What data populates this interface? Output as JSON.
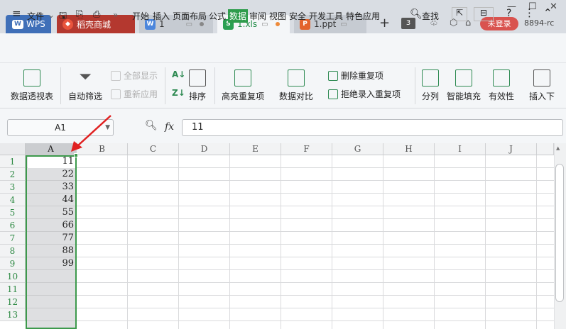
{
  "titlebar": {
    "tabs": [
      {
        "label": "WPS"
      },
      {
        "label": "稻壳商城"
      },
      {
        "label": "1"
      },
      {
        "label": "1.xls"
      },
      {
        "label": "1.ppt"
      }
    ],
    "window_count": "3",
    "login_label": "未登录",
    "user_id": "8894-rc"
  },
  "menubar": {
    "file_label": "文件",
    "items": [
      "开始",
      "插入",
      "页面布局",
      "公式",
      "数据",
      "审阅",
      "视图",
      "安全",
      "开发工具",
      "特色应用"
    ],
    "active": "数据",
    "search_label": "查找"
  },
  "ribbon": {
    "pivot": "数据透视表",
    "autofilter": "自动筛选",
    "show_all": "全部显示",
    "reapply": "重新应用",
    "sort": "排序",
    "highlight_dup": "高亮重复项",
    "compare": "数据对比",
    "delete_dup": "删除重复项",
    "reject_dup": "拒绝录入重复项",
    "split": "分列",
    "smart_fill": "智能填充",
    "validity": "有效性",
    "insert_down": "插入下"
  },
  "formula_bar": {
    "name_box": "A1",
    "fx": "fx",
    "value": "11"
  },
  "sheet": {
    "columns": [
      "A",
      "B",
      "C",
      "D",
      "E",
      "F",
      "G",
      "H",
      "I",
      "J"
    ],
    "rows": [
      "1",
      "2",
      "3",
      "4",
      "5",
      "6",
      "7",
      "8",
      "9",
      "10",
      "11",
      "12",
      "13"
    ],
    "colA_values": [
      "11",
      "22",
      "33",
      "44",
      "55",
      "66",
      "77",
      "88",
      "99"
    ]
  },
  "colors": {
    "accent_green": "#2e9c4c",
    "annotation_arrow": "#e02020",
    "login_red": "#d9534f"
  }
}
